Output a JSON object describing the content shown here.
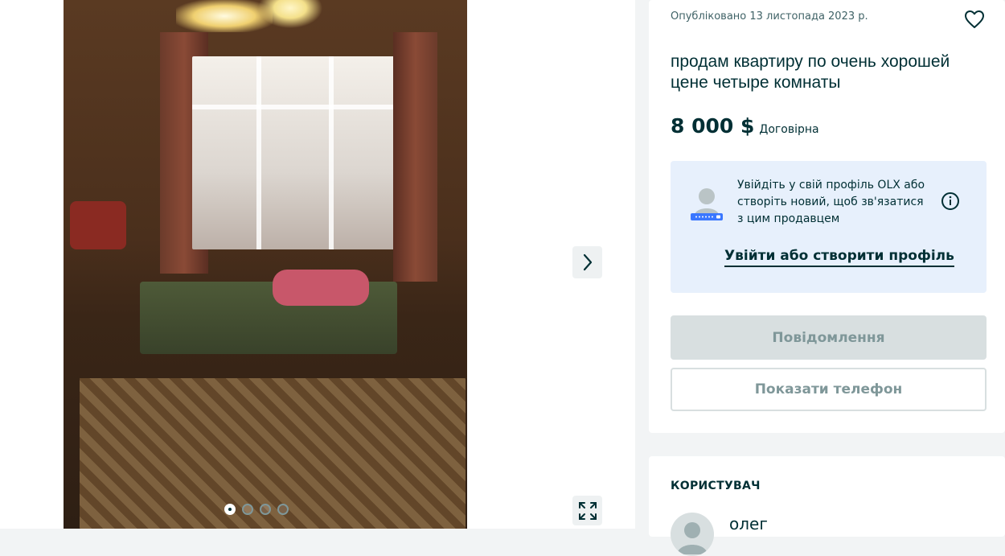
{
  "gallery": {
    "photo_alt": "",
    "slide_count": 4,
    "active_slide": 1,
    "next_icon": "chevron-right-icon",
    "expand_icon": "expand-icon"
  },
  "listing": {
    "published": "Опубліковано 13 листопада 2023 р.",
    "title": "продам квартиру по очень хорошей цене четыре комнаты",
    "price": "8 000 $",
    "negotiable": "Договірна"
  },
  "login_prompt": {
    "text": "Увійдіть у свій профіль OLX або створіть новий, щоб зв'язатися з цим продавцем",
    "link_label": "Увійти або створити профіль"
  },
  "actions": {
    "message_label": "Повідомлення",
    "phone_label": "Показати телефон"
  },
  "user": {
    "heading": "КОРИСТУВАЧ",
    "name": "олег"
  },
  "colors": {
    "primary": "#002f34",
    "muted": "#7f9799",
    "disabled_bg": "#d8dfe0",
    "info_bg": "#e7f0fc",
    "page_bg": "#f2f4f5"
  }
}
